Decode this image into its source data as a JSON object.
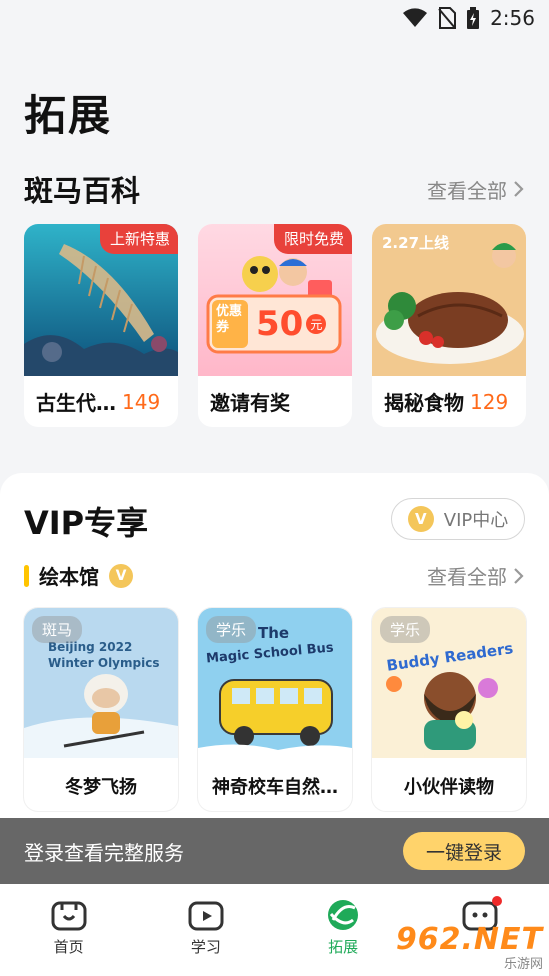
{
  "status": {
    "time": "2:56"
  },
  "page": {
    "title": "拓展"
  },
  "encyclopedia": {
    "title": "斑马百科",
    "see_all": "查看全部",
    "cards": [
      {
        "tag": "上新特惠",
        "name": "古生代…",
        "count": "149"
      },
      {
        "tag": "限时免费",
        "name": "邀请有奖",
        "count": "",
        "coupon_label": "优惠券",
        "coupon_value": "50",
        "coupon_unit": "元"
      },
      {
        "tag": "",
        "name": "揭秘食物",
        "count": "129",
        "banner": "2.27上线"
      }
    ]
  },
  "vip": {
    "title": "VIP专享",
    "center_button": "VIP中心",
    "badge": "V",
    "picture_books": {
      "title": "绘本馆",
      "see_all": "查看全部",
      "books": [
        {
          "publisher": "斑马",
          "title": "冬梦飞扬",
          "cover_line1": "Beijing 2022",
          "cover_line2": "Winter Olympics"
        },
        {
          "publisher": "学乐",
          "title": "神奇校车自然…",
          "cover_line1": "The",
          "cover_line2": "Magic School Bus"
        },
        {
          "publisher": "学乐",
          "title": "小伙伴读物",
          "cover_line1": "Buddy Readers"
        }
      ]
    }
  },
  "login_bar": {
    "text": "登录查看完整服务",
    "button": "一键登录"
  },
  "tabs": [
    {
      "label": "首页",
      "icon": "zebra-home-icon"
    },
    {
      "label": "学习",
      "icon": "zebra-study-icon"
    },
    {
      "label": "拓展",
      "icon": "explore-icon",
      "active": true
    },
    {
      "label": "",
      "icon": "zebra-mine-icon"
    }
  ],
  "watermark": {
    "main": "962.NET",
    "sub": "乐游网"
  },
  "colors": {
    "accent_green": "#1faa59",
    "tag_red": "#e8413b",
    "count_orange": "#ff6a1a",
    "vip_gold": "#f4c65a",
    "login_yellow": "#ffd36b"
  }
}
